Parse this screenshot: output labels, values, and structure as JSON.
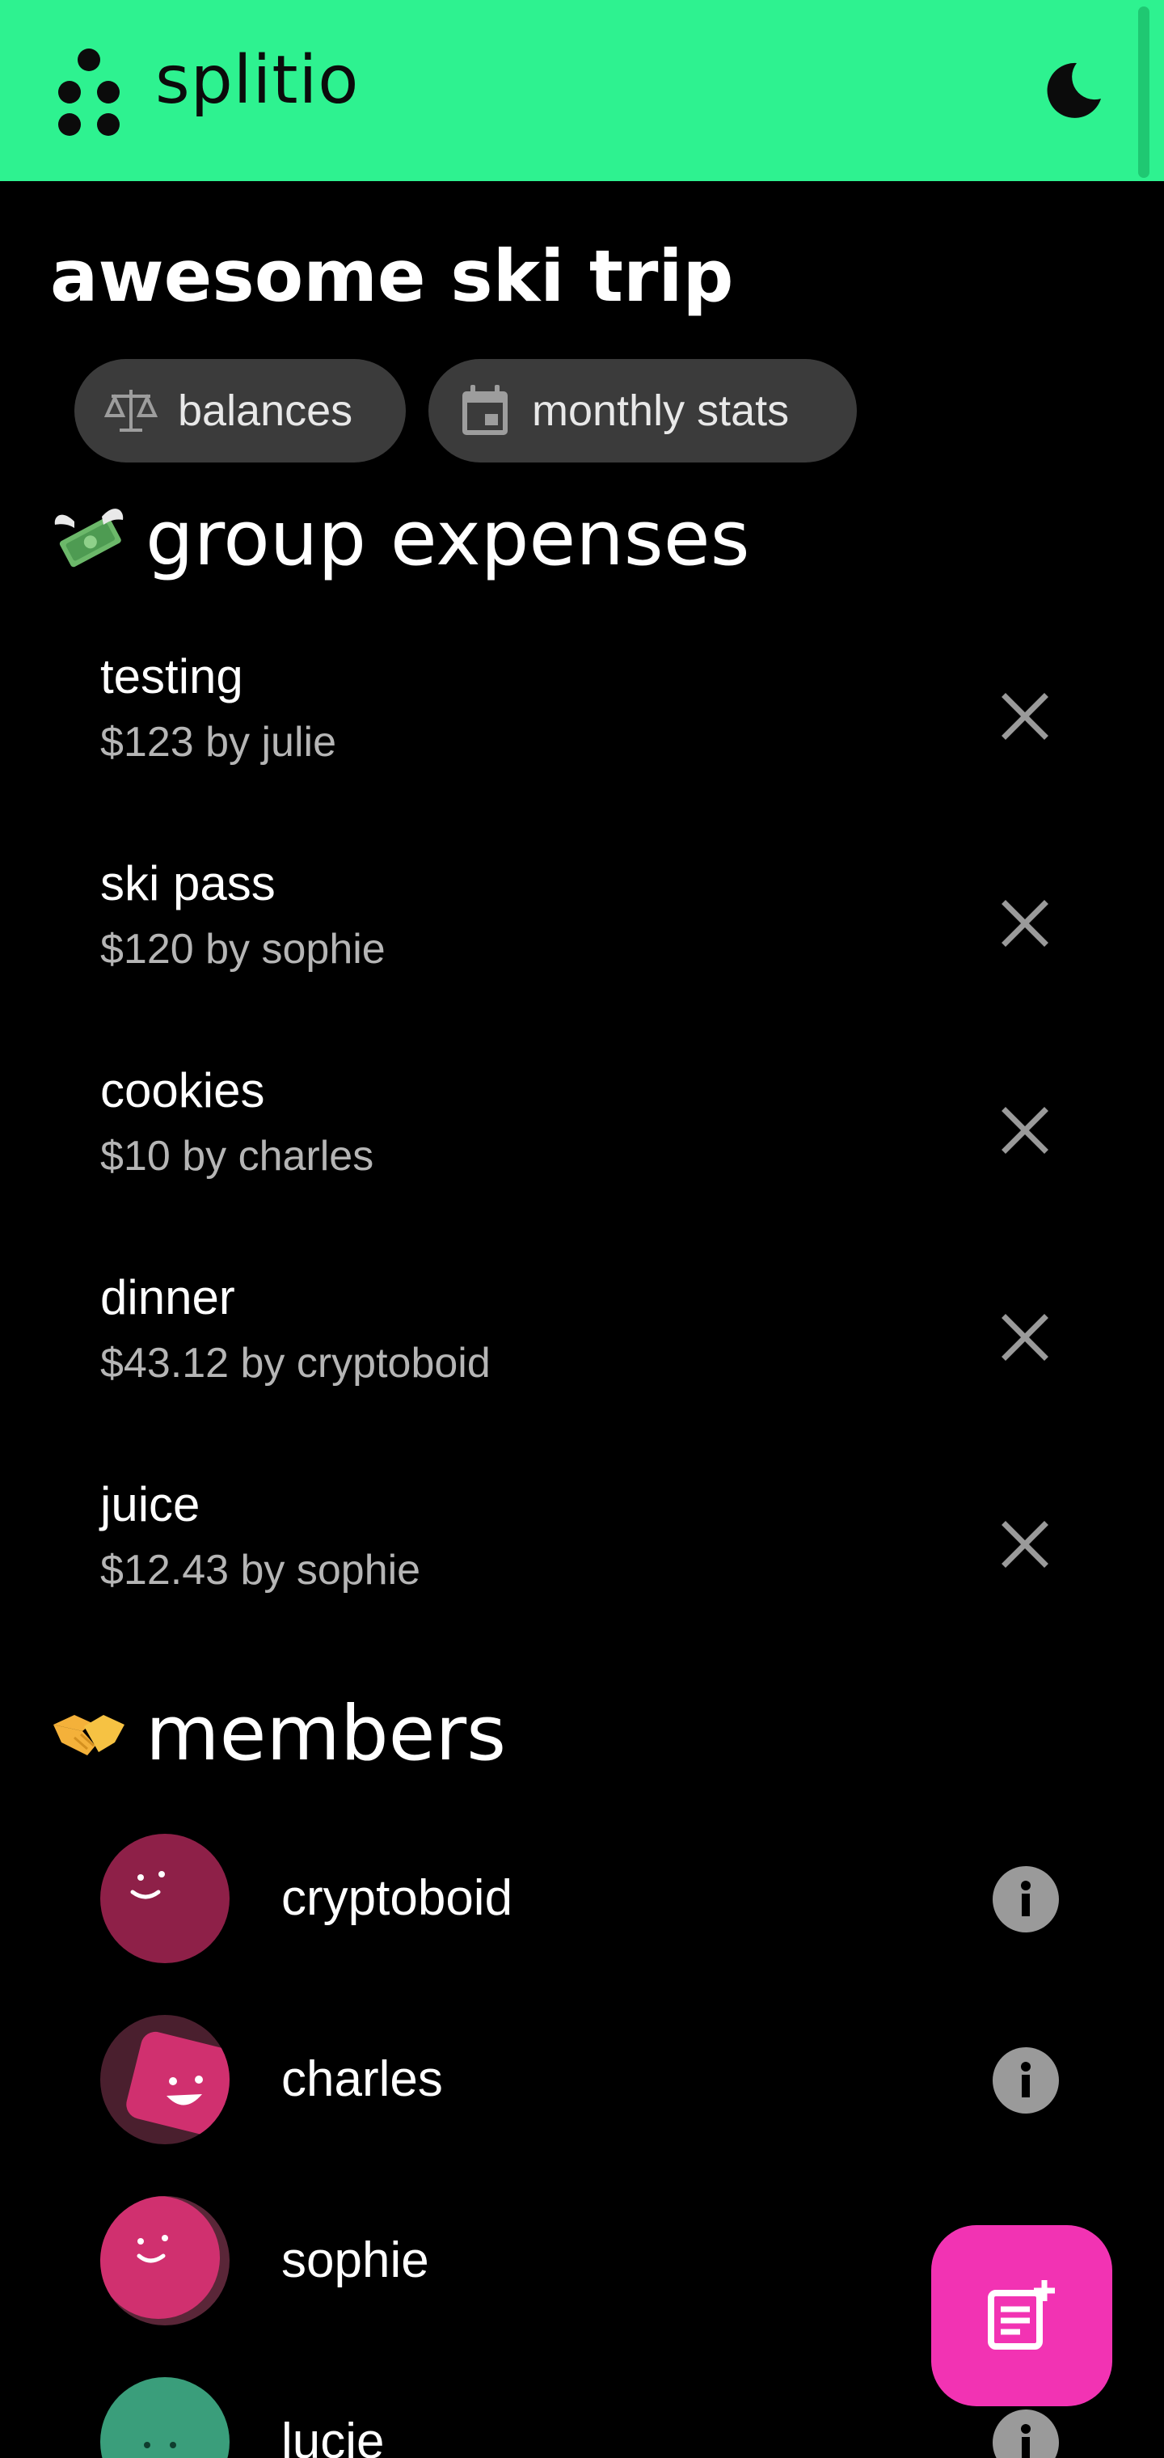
{
  "app": {
    "name": "splitio",
    "theme_toggle_icon": "moon-icon",
    "brand_color": "#2ef290",
    "accent_color": "#f233b3"
  },
  "group": {
    "title": "awesome ski trip"
  },
  "nav": {
    "chips": [
      {
        "label": "balances",
        "icon": "scale-icon"
      },
      {
        "label": "monthly stats",
        "icon": "calendar-icon"
      }
    ]
  },
  "expenses_section": {
    "title": "group expenses",
    "icon": "money-with-wings-icon",
    "items": [
      {
        "name": "testing",
        "meta": "$123 by julie"
      },
      {
        "name": "ski pass",
        "meta": "$120 by sophie"
      },
      {
        "name": "cookies",
        "meta": "$10 by charles"
      },
      {
        "name": "dinner",
        "meta": "$43.12 by cryptoboid"
      },
      {
        "name": "juice",
        "meta": "$12.43 by sophie"
      }
    ]
  },
  "members_section": {
    "title": "members",
    "icon": "handshake-icon",
    "items": [
      {
        "name": "cryptoboid",
        "avatar_color": "#8e2048"
      },
      {
        "name": "charles",
        "avatar_color": "#d0306f"
      },
      {
        "name": "sophie",
        "avatar_color": "#d0306f"
      },
      {
        "name": "lucie",
        "avatar_color": "#3a9e7b"
      }
    ]
  },
  "fab": {
    "icon": "add-note-icon"
  }
}
